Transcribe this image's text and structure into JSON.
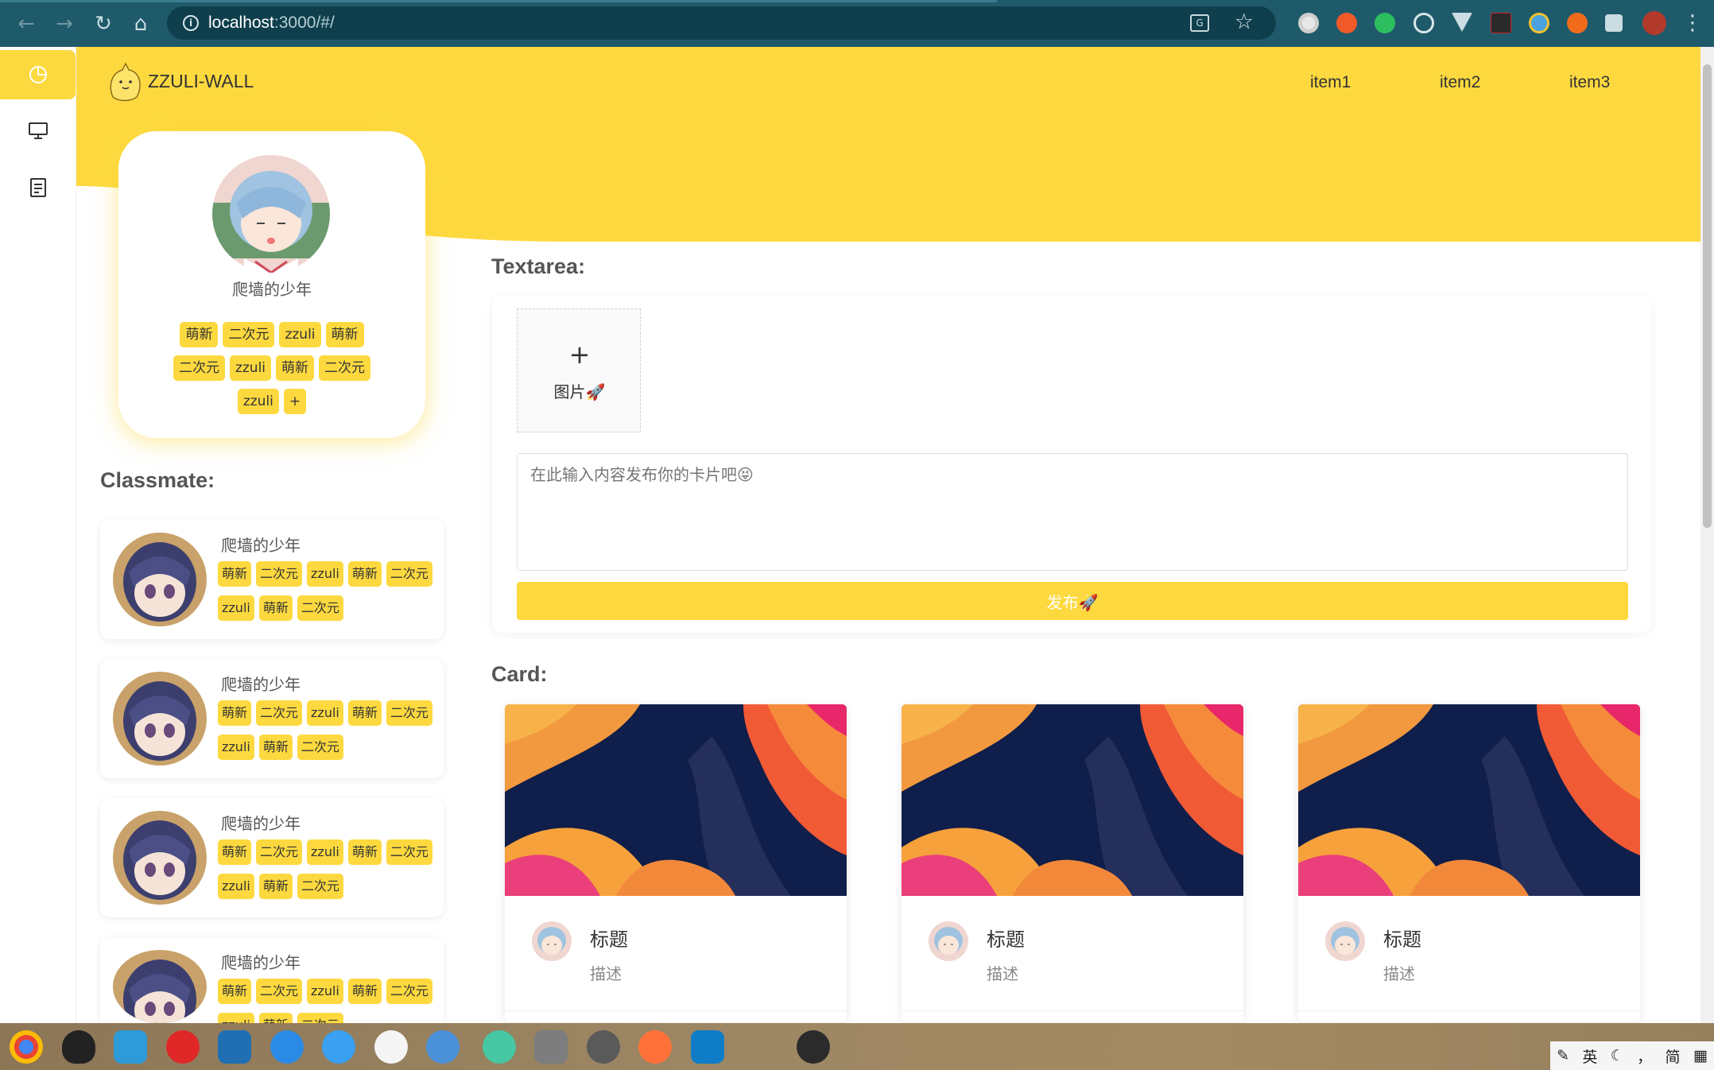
{
  "browser": {
    "url_host": "localhost",
    "url_rest": ":3000/#/",
    "extensions": [
      "circle-ext",
      "infinity-ext",
      "evernote-ext",
      "target-ext",
      "vue-ext",
      "h-ext",
      "globe-ext",
      "orange-ext",
      "puzzle-ext",
      "profile-avatar"
    ]
  },
  "header": {
    "brand": "ZZULI-WALL",
    "nav": [
      "item1",
      "item2",
      "item3"
    ]
  },
  "profile": {
    "name": "爬墙的少年",
    "tags": [
      "萌新",
      "二次元",
      "zzuli",
      "萌新",
      "二次元",
      "zzuli",
      "萌新",
      "二次元",
      "zzuli"
    ],
    "add_tag": "+"
  },
  "classmates": {
    "title": "Classmate:",
    "items": [
      {
        "name": "爬墙的少年",
        "tags": [
          "萌新",
          "二次元",
          "zzuli",
          "萌新",
          "二次元",
          "zzuli",
          "萌新",
          "二次元"
        ]
      },
      {
        "name": "爬墙的少年",
        "tags": [
          "萌新",
          "二次元",
          "zzuli",
          "萌新",
          "二次元",
          "zzuli",
          "萌新",
          "二次元"
        ]
      },
      {
        "name": "爬墙的少年",
        "tags": [
          "萌新",
          "二次元",
          "zzuli",
          "萌新",
          "二次元",
          "zzuli",
          "萌新",
          "二次元"
        ]
      },
      {
        "name": "爬墙的少年",
        "tags": [
          "萌新",
          "二次元",
          "zzuli",
          "萌新",
          "二次元",
          "zzuli",
          "萌新",
          "二次元"
        ]
      }
    ]
  },
  "textarea": {
    "title": "Textarea:",
    "upload_plus": "+",
    "upload_label": "图片🚀",
    "placeholder": "在此输入内容发布你的卡片吧😝",
    "publish": "发布🚀"
  },
  "cards": {
    "title": "Card:",
    "items": [
      {
        "title": "标题",
        "desc": "描述"
      },
      {
        "title": "标题",
        "desc": "描述"
      },
      {
        "title": "标题",
        "desc": "描述"
      }
    ]
  },
  "tray": [
    "英",
    "简"
  ],
  "colors": {
    "accent": "#fdd93f",
    "chrome": "#1f5a6b"
  }
}
